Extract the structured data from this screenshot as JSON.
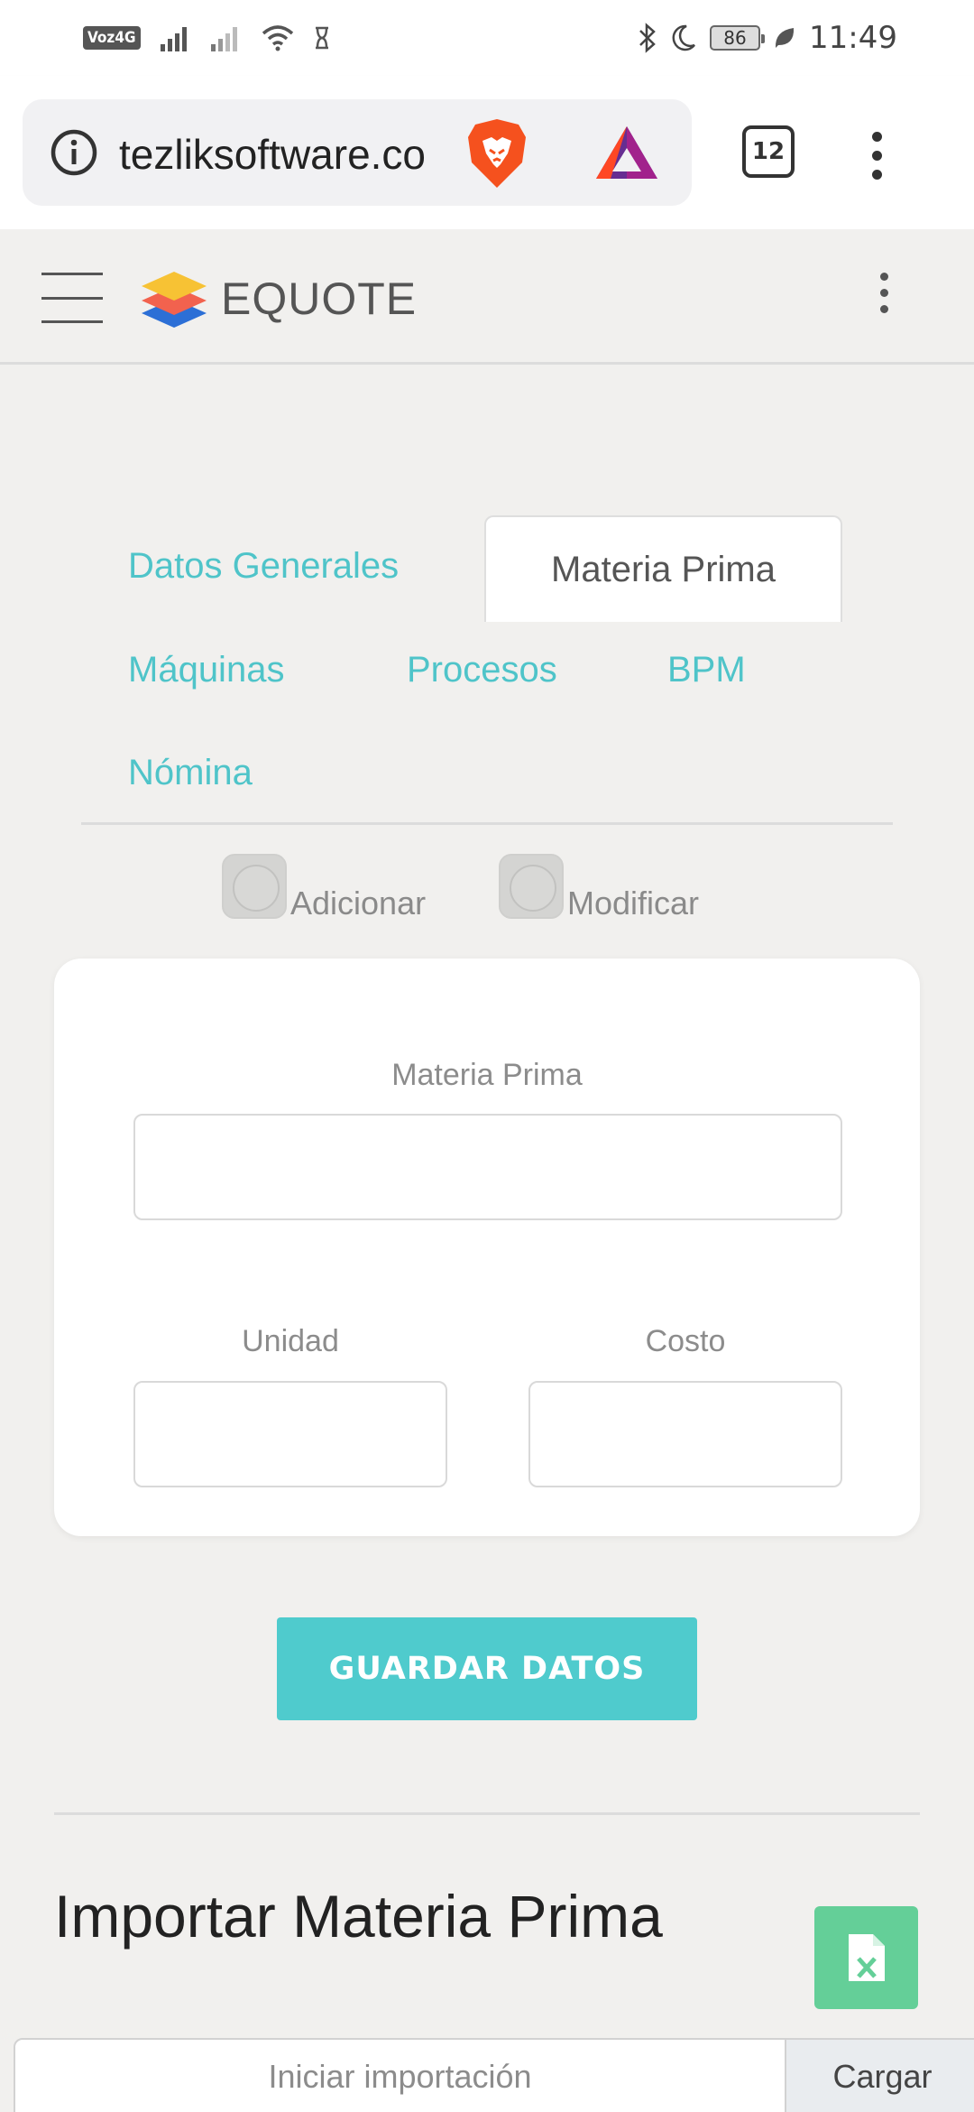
{
  "status_bar": {
    "network_badge": "Voz4G",
    "time": "11:49",
    "battery": "86"
  },
  "browser": {
    "url": "tezliksoftware.co",
    "tab_count": "12"
  },
  "app": {
    "brand": "EQUOTE"
  },
  "tabs": {
    "datos_generales": "Datos Generales",
    "materia_prima": "Materia Prima",
    "maquinas": "Máquinas",
    "procesos": "Procesos",
    "bpm": "BPM",
    "nomina": "Nómina"
  },
  "mode": {
    "add_label": "Adicionar",
    "modify_label": "Modificar"
  },
  "form": {
    "materia_prima_label": "Materia Prima",
    "materia_prima_value": "",
    "unidad_label": "Unidad",
    "unidad_value": "",
    "costo_label": "Costo",
    "costo_value": ""
  },
  "save_button": "GUARDAR DATOS",
  "import": {
    "title": "Importar Materia Prima",
    "placeholder": "Iniciar importación",
    "load_label": "Cargar"
  },
  "colors": {
    "accent_teal": "#4fc4c9",
    "save_button": "#4fcbcd",
    "excel_green": "#64cf98",
    "background": "#f1f0ee"
  }
}
